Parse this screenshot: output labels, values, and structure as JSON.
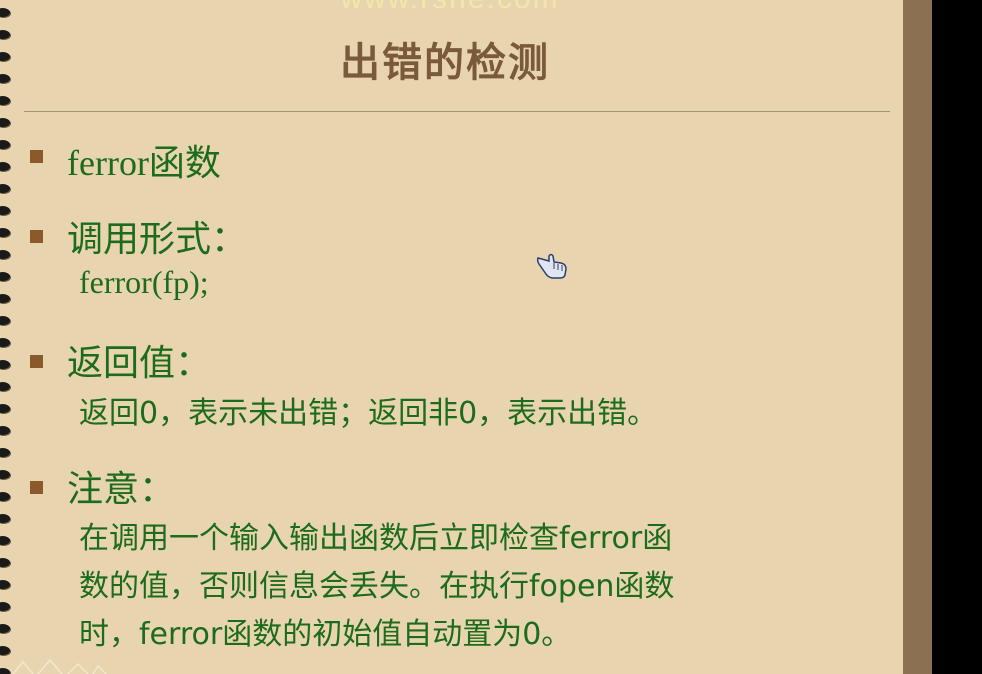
{
  "watermark": "www.rsne.com",
  "title": "出错的检测",
  "sections": [
    {
      "heading": "ferror函数",
      "lines": []
    },
    {
      "heading": "调用形式：",
      "lines": [
        "ferror(fp);"
      ]
    },
    {
      "heading": "返回值：",
      "lines": [
        "返回0，表示未出错；返回非0，表示出错。"
      ]
    },
    {
      "heading": "注意：",
      "lines": [
        "在调用一个输入输出函数后立即检查ferror函",
        "数的值，否则信息会丢失。在执行fopen函数",
        "时，ferror函数的初始值自动置为0。"
      ]
    }
  ],
  "colors": {
    "background": "#e8d5b0",
    "text": "#1d6b1d",
    "title": "#7a5a3a",
    "bullet": "#8b5a2b"
  },
  "icons": {
    "cursor": "hand-pointer-icon"
  }
}
